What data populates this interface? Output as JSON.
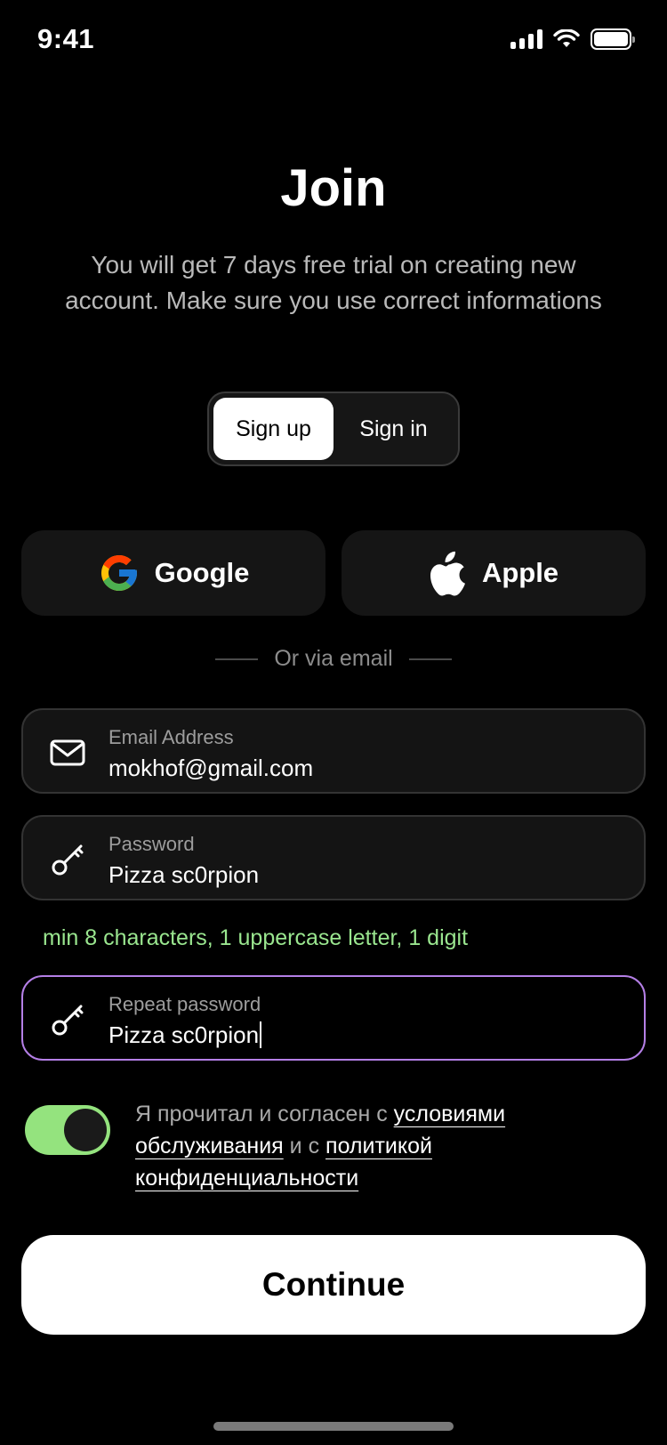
{
  "status_bar": {
    "time": "9:41",
    "signal_icon": "cellular-signal-icon",
    "wifi_icon": "wifi-icon",
    "battery_icon": "battery-icon"
  },
  "header": {
    "title": "Join",
    "subtitle": "You will get 7 days free trial on creating new account. Make sure you use correct informations"
  },
  "auth_tabs": {
    "items": [
      {
        "label": "Sign up",
        "active": true
      },
      {
        "label": "Sign in",
        "active": false
      }
    ]
  },
  "social": {
    "google_label": "Google",
    "apple_label": "Apple",
    "google_icon": "google-logo-icon",
    "apple_icon": "apple-logo-icon"
  },
  "divider": {
    "text": "Or via email"
  },
  "form": {
    "email": {
      "label": "Email Address",
      "value": "mokhof@gmail.com",
      "icon": "mail-icon"
    },
    "password": {
      "label": "Password",
      "value": "Pizza sc0rpion",
      "icon": "key-icon"
    },
    "password_hint": "min 8 characters, 1 uppercase letter, 1 digit",
    "repeat_password": {
      "label": "Repeat password",
      "value": "Pizza sc0rpion",
      "icon": "key-icon",
      "focused": true
    }
  },
  "terms": {
    "toggle_on": true,
    "part1": "Я прочитал и согласен с ",
    "link1": "условиями обслуживания",
    "part2": " и с ",
    "link2": "политикой конфиденциальности"
  },
  "continue_label": "Continue",
  "colors": {
    "accent_green": "#94e37e",
    "focus_border": "#b47fe6",
    "hint_green": "#9ae68f"
  }
}
